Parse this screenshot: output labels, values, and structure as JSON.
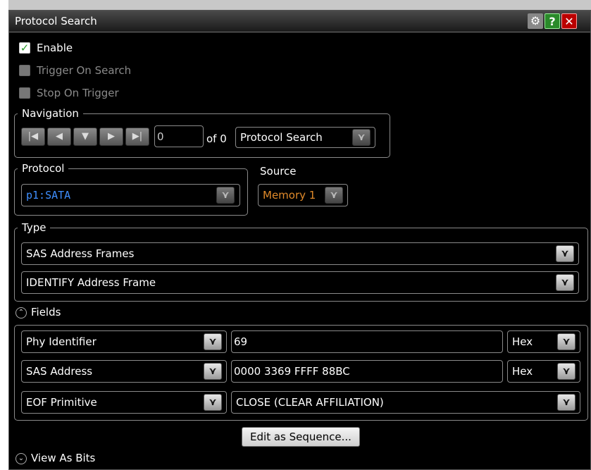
{
  "dialog": {
    "title": "Protocol Search"
  },
  "options": {
    "enable": {
      "label": "Enable",
      "checked": true
    },
    "trigger_on_search": {
      "label": "Trigger On Search",
      "checked": false
    },
    "stop_on_trigger": {
      "label": "Stop On Trigger",
      "checked": false
    }
  },
  "navigation": {
    "legend": "Navigation",
    "index_value": "0",
    "of_label": "of 0",
    "target": "Protocol Search"
  },
  "protocol": {
    "legend": "Protocol",
    "value": "p1:SATA"
  },
  "source": {
    "label": "Source",
    "value": "Memory 1"
  },
  "type": {
    "legend": "Type",
    "frame_type": "SAS Address Frames",
    "frame": "IDENTIFY Address Frame"
  },
  "fields": {
    "label": "Fields",
    "rows": [
      {
        "name": "Phy Identifier",
        "value": "69",
        "format": "Hex"
      },
      {
        "name": "SAS Address",
        "value": "0000 3369 FFFF 88BC",
        "format": "Hex"
      },
      {
        "name": "EOF Primitive",
        "value": "CLOSE (CLEAR AFFILIATION)"
      }
    ]
  },
  "buttons": {
    "edit_sequence": "Edit as Sequence..."
  },
  "view_as_bits": {
    "label": "View As Bits"
  },
  "colors": {
    "protocol_text": "#3f8fff",
    "source_text": "#e08a2a",
    "check_green": "#2a9a2a"
  }
}
